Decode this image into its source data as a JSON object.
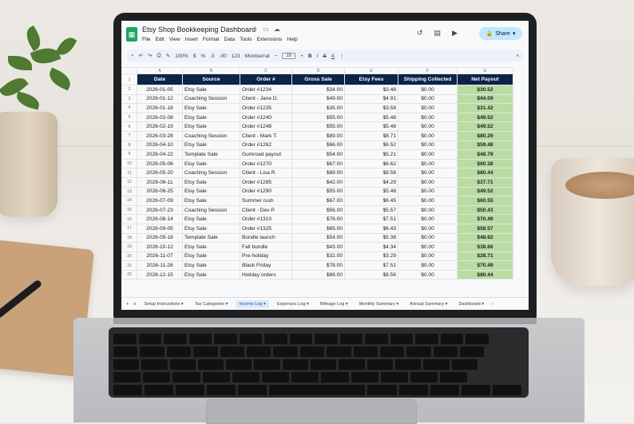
{
  "app": {
    "title": "Etsy Shop Bookkeeping Dashboard",
    "logo_icon": "sheets-logo-icon",
    "menus": [
      "File",
      "Edit",
      "View",
      "Insert",
      "Format",
      "Data",
      "Tools",
      "Extensions",
      "Help"
    ],
    "share_label": "Share"
  },
  "toolbar": {
    "zoom": "100%",
    "currency": "$",
    "percent": "%",
    "decimal_dec": ".0",
    "decimal_inc": ".00",
    "number_format": "123",
    "font": "Montserrat",
    "font_size": "10",
    "bold": "B",
    "italic": "I",
    "text_color": "A"
  },
  "columns": [
    "A",
    "B",
    "C",
    "D",
    "E",
    "F",
    "G"
  ],
  "headers": [
    "Date",
    "Source",
    "Order #",
    "Gross Sale",
    "Etsy Fees",
    "Shipping Collected",
    "Net Payout"
  ],
  "rows": [
    [
      "2026-01-05",
      "Etsy Sale",
      "Order #1234",
      "$34.00",
      "$3.48",
      "$0.00",
      "$30.52"
    ],
    [
      "2026-01-12",
      "Coaching Session",
      "Client - Jane D.",
      "$49.00",
      "$4.91",
      "$0.00",
      "$44.09"
    ],
    [
      "2026-01-18",
      "Etsy Sale",
      "Order #1235",
      "$35.00",
      "$3.58",
      "$0.00",
      "$31.42"
    ],
    [
      "2026-02-08",
      "Etsy Sale",
      "Order #1240",
      "$55.00",
      "$5.48",
      "$0.00",
      "$49.52"
    ],
    [
      "2026-02-19",
      "Etsy Sale",
      "Order #1248",
      "$55.00",
      "$5.48",
      "$0.00",
      "$49.52"
    ],
    [
      "2026-03-28",
      "Coaching Session",
      "Client - Mark T.",
      "$89.00",
      "$8.71",
      "$0.00",
      "$80.29"
    ],
    [
      "2026-04-10",
      "Etsy Sale",
      "Order #1262",
      "$66.00",
      "$6.52",
      "$0.00",
      "$59.48"
    ],
    [
      "2026-04-22",
      "Template Sale",
      "Gumroad payout",
      "$54.00",
      "$5.21",
      "$0.00",
      "$48.79"
    ],
    [
      "2026-05-06",
      "Etsy Sale",
      "Order #1270",
      "$67.00",
      "$6.62",
      "$0.00",
      "$60.38"
    ],
    [
      "2026-05-20",
      "Coaching Session",
      "Client - Lisa R.",
      "$89.00",
      "$8.56",
      "$0.00",
      "$80.44"
    ],
    [
      "2026-06-11",
      "Etsy Sale",
      "Order #1285",
      "$42.00",
      "$4.29",
      "$0.00",
      "$37.71"
    ],
    [
      "2026-06-25",
      "Etsy Sale",
      "Order #1290",
      "$55.00",
      "$5.48",
      "$0.00",
      "$49.52"
    ],
    [
      "2026-07-09",
      "Etsy Sale",
      "Summer rush",
      "$67.00",
      "$6.45",
      "$0.00",
      "$60.55"
    ],
    [
      "2026-07-23",
      "Coaching Session",
      "Client - Dev P.",
      "$56.00",
      "$5.57",
      "$0.00",
      "$50.43"
    ],
    [
      "2026-08-14",
      "Etsy Sale",
      "Order #1310",
      "$78.00",
      "$7.51",
      "$0.00",
      "$70.49"
    ],
    [
      "2026-09-05",
      "Etsy Sale",
      "Order #1325",
      "$65.00",
      "$6.43",
      "$0.00",
      "$58.57"
    ],
    [
      "2026-09-18",
      "Template Sale",
      "Bundle launch",
      "$54.00",
      "$5.38",
      "$0.00",
      "$48.62"
    ],
    [
      "2026-10-12",
      "Etsy Sale",
      "Fall bundle",
      "$43.00",
      "$4.34",
      "$0.00",
      "$38.66"
    ],
    [
      "2026-11-07",
      "Etsy Sale",
      "Pre-holiday",
      "$32.00",
      "$3.29",
      "$0.00",
      "$28.71"
    ],
    [
      "2026-11-28",
      "Etsy Sale",
      "Black Friday",
      "$78.00",
      "$7.51",
      "$0.00",
      "$70.49"
    ],
    [
      "2026-12-15",
      "Etsy Sale",
      "Holiday orders",
      "$89.00",
      "$8.56",
      "$0.00",
      "$80.44"
    ]
  ],
  "tabs": [
    "Setup Instructions",
    "Tax Categories",
    "Income Log",
    "Expenses Log",
    "Mileage Log",
    "Monthly Summary",
    "Annual Summary",
    "Dashboard"
  ],
  "active_tab": "Income Log",
  "colors": {
    "header_bg": "#0b2447",
    "net_payout_bg": "#b9dca2",
    "share_bg": "#c2e7ff"
  }
}
